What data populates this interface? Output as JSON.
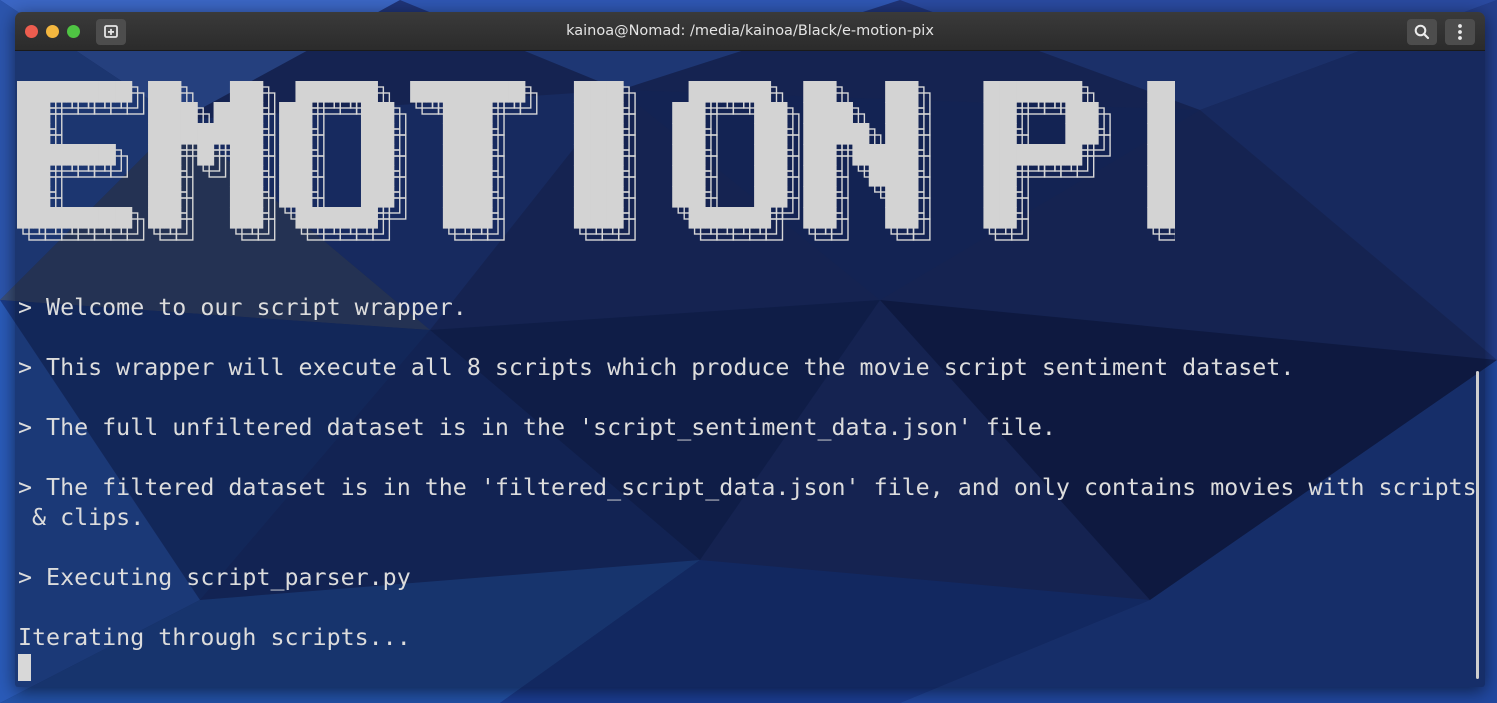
{
  "window": {
    "title": "kainoa@Nomad: /media/kainoa/Black/e-motion-pix"
  },
  "titlebar_icons": {
    "new_tab": "new-tab-icon",
    "search": "search-icon",
    "menu": "kebab-menu-icon"
  },
  "banner": {
    "text": "EMOTION PIX"
  },
  "terminal": {
    "lines": [
      "> Welcome to our script wrapper.",
      "",
      "> This wrapper will execute all 8 scripts which produce the movie script sentiment dataset.",
      "",
      "> The full unfiltered dataset is in the 'script_sentiment_data.json' file.",
      "",
      "> The filtered dataset is in the 'filtered_script_data.json' file, and only contains movies with scripts",
      " & clips.",
      "",
      "> Executing script_parser.py",
      "",
      "Iterating through scripts..."
    ]
  },
  "colors": {
    "close": "#ed5d4f",
    "minimize": "#f4b73f",
    "maximize": "#4fc443",
    "terminal_text": "#dcdcdc",
    "wallpaper_base": "#1d2c66"
  }
}
